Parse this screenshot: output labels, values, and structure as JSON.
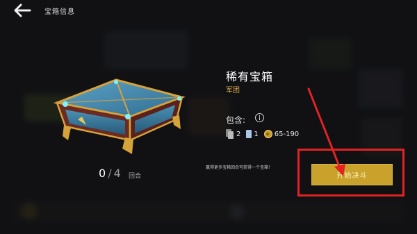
{
  "header": {
    "title": "宝箱信息"
  },
  "chest": {
    "name": "稀有宝箱",
    "subtitle": "军团",
    "progress_current": "0",
    "progress_separator": "/",
    "progress_total": "4",
    "progress_label": "回合"
  },
  "contents": {
    "label": "包含:",
    "rewards": [
      {
        "icon": "card-stack-icon",
        "value": "2"
      },
      {
        "icon": "card-icon",
        "value": "1"
      },
      {
        "icon": "coin-icon",
        "value": "65-190"
      }
    ]
  },
  "hint": "赢得更多宝箱回合可获得一个宝箱！",
  "actions": {
    "start_label": "开始决斗"
  },
  "colors": {
    "accent_gold": "#c8a22b",
    "subtitle_gold": "#d6a84a",
    "annotation_red": "#e32222"
  }
}
